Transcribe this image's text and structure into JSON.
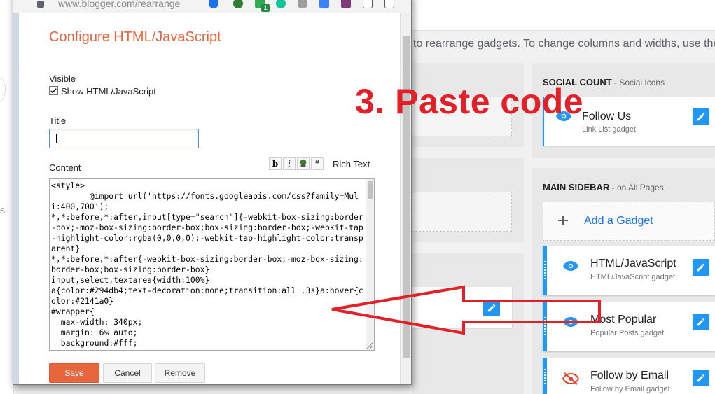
{
  "browser": {
    "url": "www.blogger.com/rearrange",
    "badge_count": "1"
  },
  "background": {
    "hint": "to rearrange gadgets. To change columns and widths, use the",
    "left_fragment": "s",
    "social_count": {
      "title": "SOCIAL COUNT",
      "subtitle": " - Social Icons",
      "gadget": {
        "name": "Follow Us",
        "type": "Link List gadget"
      }
    },
    "main_sidebar": {
      "title": "MAIN SIDEBAR",
      "subtitle": " - on All Pages",
      "add_label": "Add a Gadget",
      "gadgets": [
        {
          "name": "HTML/JavaScript",
          "type": "HTML/JavaScript gadget"
        },
        {
          "name": "Most Popular",
          "type": "Popular Posts gadget"
        },
        {
          "name": "Follow by Email",
          "type": "Follow by Email gadget"
        }
      ]
    }
  },
  "dialog": {
    "title": "Configure HTML/JavaScript",
    "visible_label": "Visible",
    "show_label": "Show HTML/JavaScript",
    "title_label": "Title",
    "title_value": "",
    "content_label": "Content",
    "rich_text_label": "Rich Text",
    "code": "<style>\n        @import url('https://fonts.googleapis.com/css?family=Muli:400,700');\n*,*:before,*:after,input[type=\"search\"]{-webkit-box-sizing:border-box;-moz-box-sizing:border-box;box-sizing:border-box;-webkit-tap-highlight-color:rgba(0,0,0,0);-webkit-tap-highlight-color:transparent}\n*,*:before,*:after{-webkit-box-sizing:border-box;-moz-box-sizing:border-box;box-sizing:border-box}\ninput,select,textarea{width:100%}\na{color:#294db4;text-decoration:none;transition:all .3s}a:hover{color:#2141a0}\n#wrapper{\n  max-width: 340px;\n  margin: 6% auto;\n  background:#fff;",
    "save_label": "Save",
    "cancel_label": "Cancel",
    "remove_label": "Remove"
  },
  "annotation": {
    "text": "3. Paste code",
    "color": "#e32027"
  },
  "colors": {
    "accent": "#e8663d",
    "blue": "#2196f3",
    "link": "#1a73e8"
  }
}
